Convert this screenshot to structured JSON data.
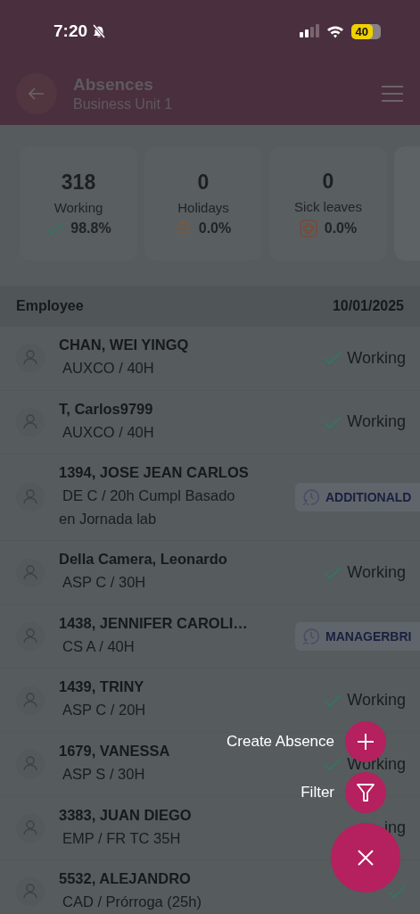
{
  "status_bar": {
    "time": "7:20",
    "battery": "40"
  },
  "header": {
    "title": "Absences",
    "subtitle": "Business Unit 1"
  },
  "stats": [
    {
      "kind": "working",
      "count": "318",
      "label": "Working",
      "percent": "98.8%"
    },
    {
      "kind": "holidays",
      "count": "0",
      "label": "Holidays",
      "percent": "0.0%"
    },
    {
      "kind": "sick",
      "count": "0",
      "label": "Sick leaves",
      "percent": "0.0%"
    }
  ],
  "table": {
    "columns": [
      "Employee",
      "10/01/2025"
    ],
    "rows": [
      {
        "name": "CHAN, WEI YINGQ",
        "detail": "AUXCO / 40H",
        "status": {
          "kind": "working",
          "label": "Working"
        }
      },
      {
        "name": "T, Carlos9799",
        "detail": "AUXCO / 40H",
        "status": {
          "kind": "working",
          "label": "Working"
        }
      },
      {
        "name": "1394, JOSE JEAN CARLOS",
        "detail": "DE C / 20h Cumpl Basado en Jornada lab",
        "status": {
          "kind": "badge",
          "label": "ADDITIONALD"
        }
      },
      {
        "name": "Della Camera, Leonardo",
        "detail": "ASP C / 30H",
        "status": {
          "kind": "working",
          "label": "Working"
        }
      },
      {
        "name": "1438, JENNIFER CAROLI…",
        "detail": "CS A / 40H",
        "status": {
          "kind": "badge",
          "label": "MANAGERBRI"
        }
      },
      {
        "name": "1439, TRINY",
        "detail": "ASP C / 20H",
        "status": {
          "kind": "working",
          "label": "Working"
        }
      },
      {
        "name": "1679, VANESSA",
        "detail": "ASP S / 30H",
        "status": {
          "kind": "working",
          "label": "Working"
        }
      },
      {
        "name": "3383, JUAN DIEGO",
        "detail": "EMP / FR TC 35H",
        "status": {
          "kind": "working",
          "label": "ing"
        }
      },
      {
        "name": "5532, ALEJANDRO",
        "detail": "CAD / Prórroga (25h)",
        "status": {
          "kind": "working"
        }
      }
    ]
  },
  "fab_menu": {
    "actions": [
      {
        "kind": "create",
        "label": "Create Absence"
      },
      {
        "kind": "filter",
        "label": "Filter"
      }
    ]
  }
}
